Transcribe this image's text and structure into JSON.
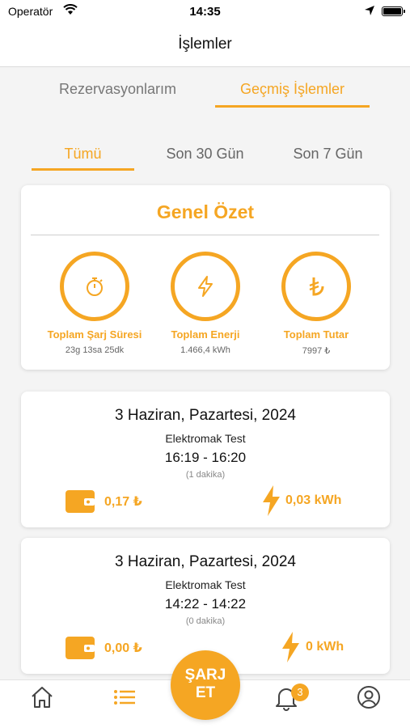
{
  "status_bar": {
    "carrier": "Operatör",
    "time": "14:35"
  },
  "header": {
    "title": "İşlemler"
  },
  "top_tabs": [
    {
      "label": "Rezervasyonlarım",
      "active": false
    },
    {
      "label": "Geçmiş İşlemler",
      "active": true
    }
  ],
  "filter_tabs": [
    {
      "label": "Tümü",
      "active": true
    },
    {
      "label": "Son 30 Gün",
      "active": false
    },
    {
      "label": "Son 7 Gün",
      "active": false
    }
  ],
  "summary": {
    "title": "Genel Özet",
    "stats": [
      {
        "icon": "stopwatch-icon",
        "label": "Toplam Şarj Süresi",
        "value": "23g 13sa 25dk"
      },
      {
        "icon": "lightning-icon",
        "label": "Toplam Enerji",
        "value": "1.466,4 kWh"
      },
      {
        "icon": "lira-icon",
        "label": "Toplam Tutar",
        "value": "7997 ₺"
      }
    ]
  },
  "transactions": [
    {
      "date": "3 Haziran, Pazartesi, 2024",
      "station": "Elektromak Test",
      "time": "16:19 - 16:20",
      "duration": "(1 dakika)",
      "cost": "0,17 ₺",
      "energy": "0,03 kWh"
    },
    {
      "date": "3 Haziran, Pazartesi, 2024",
      "station": "Elektromak Test",
      "time": "14:22 - 14:22",
      "duration": "(0 dakika)",
      "cost": "0,00 ₺",
      "energy": "0 kWh"
    }
  ],
  "tab_bar": {
    "charge_button": {
      "line1": "ŞARJ",
      "line2": "ET"
    },
    "notification_count": "3"
  },
  "colors": {
    "accent": "#f5a623",
    "background": "#f4f4f4"
  }
}
